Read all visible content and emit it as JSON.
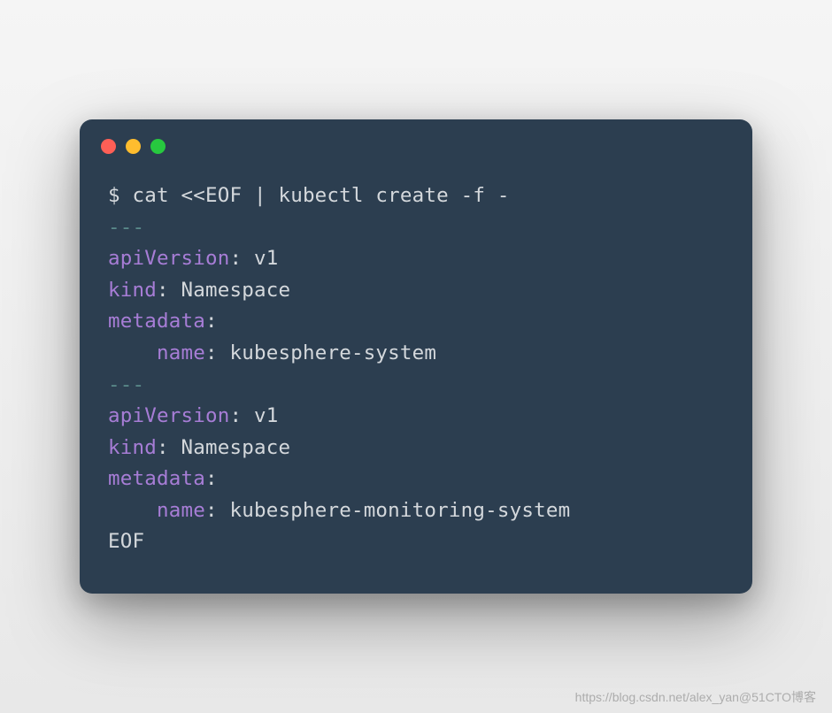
{
  "terminal": {
    "prompt_line": "$ cat <<EOF | kubectl create -f -",
    "separator": "---",
    "block1": {
      "apiVersion_key": "apiVersion",
      "apiVersion_val": " v1",
      "kind_key": "kind",
      "kind_val": " Namespace",
      "metadata_key": "metadata",
      "name_key": "    name",
      "name_val": " kubesphere-system"
    },
    "block2": {
      "apiVersion_key": "apiVersion",
      "apiVersion_val": " v1",
      "kind_key": "kind",
      "kind_val": " Namespace",
      "metadata_key": "metadata",
      "name_key": "    name",
      "name_val": " kubesphere-monitoring-system"
    },
    "eof": "EOF"
  },
  "watermark": "https://blog.csdn.net/alex_yan@51CTO博客"
}
